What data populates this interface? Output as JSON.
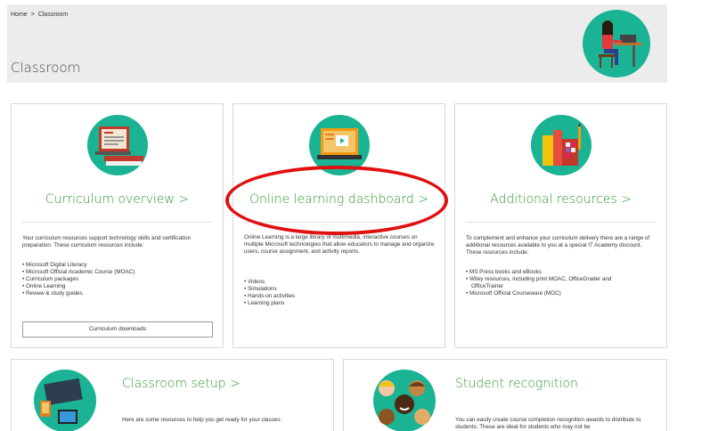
{
  "breadcrumb": {
    "home": "Home",
    "separator": ">",
    "current": "Classroom"
  },
  "page": {
    "title": "Classroom"
  },
  "cards": {
    "curriculum": {
      "title": "Curriculum overview >",
      "intro": "Your curriculum resources support technology skills and certification preparation. These curriculum resources include:",
      "items": [
        "Microsoft Digital Literacy",
        "Microsoft Official Academic Course (MOAC)",
        "Curriculum packages",
        "Online Learning",
        "Review & study guides"
      ],
      "button": "Curriculum downloads"
    },
    "online": {
      "title": "Online learning dashboard >",
      "intro": "Online Learning is a large library of multimedia, interactive courses on multiple Microsoft technologies that allow educators to manage and organize users, course assignment, and activity reports.",
      "items": [
        "Videos",
        "Simulations",
        "Hands-on activities",
        "Learning plans"
      ]
    },
    "additional": {
      "title": "Additional resources >",
      "intro": "To complement and enhance your curriculum delivery there are a range of additional resources available to you at a special IT Academy discount. These resources include:",
      "items": [
        "MS Press books and eBooks",
        "Wiley resources, including print MOAC, OfficeGrader and",
        "OfficeTrainer",
        "Microsoft Official Courseware (MOC)"
      ]
    },
    "setup": {
      "title": "Classroom setup >",
      "intro": "Here are some resources to help you get ready for your classes:"
    },
    "recognition": {
      "title": "Student recognition",
      "intro": "You can easily create course completion recognition awards to distribute to students. These are ideal for students who may not be"
    }
  },
  "colors": {
    "accent_green": "#2f9b2f",
    "teal": "#1ab394",
    "annotation_red": "#e01010"
  },
  "icons": {
    "hero": "student-at-desk-icon",
    "curriculum": "laptop-books-icon",
    "online": "laptop-video-icon",
    "additional": "books-stack-icon",
    "setup": "devices-icon",
    "recognition": "students-faces-icon"
  }
}
